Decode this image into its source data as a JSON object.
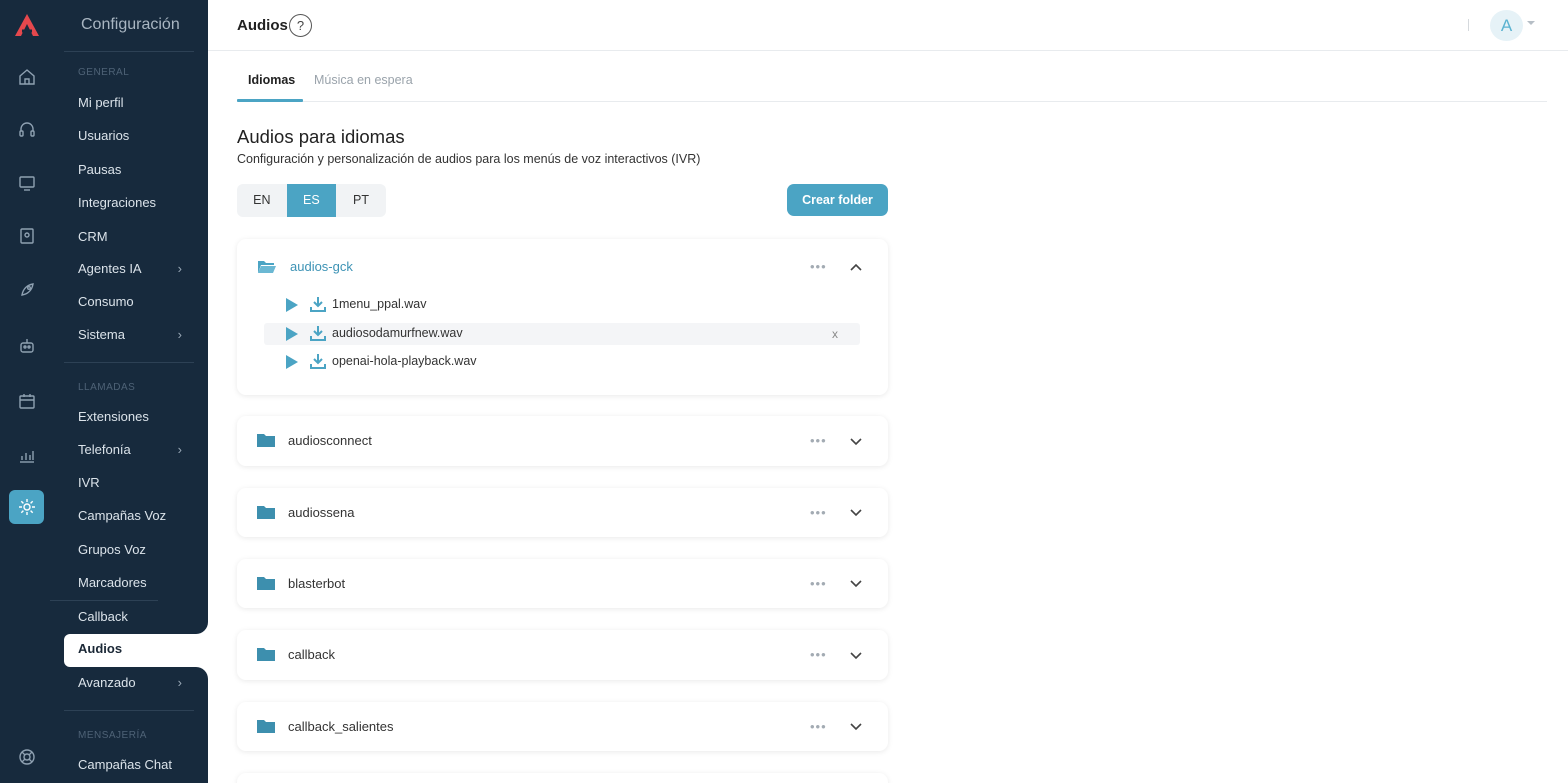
{
  "sidebar": {
    "title": "Configuración",
    "sections": {
      "general": "GENERAL",
      "llamadas": "LLAMADAS",
      "mensajeria": "MENSAJERÍA"
    },
    "items": {
      "mi_perfil": "Mi perfil",
      "usuarios": "Usuarios",
      "pausas": "Pausas",
      "integraciones": "Integraciones",
      "crm": "CRM",
      "agentes_ia": "Agentes IA",
      "consumo": "Consumo",
      "sistema": "Sistema",
      "extensiones": "Extensiones",
      "telefonia": "Telefonía",
      "ivr": "IVR",
      "campanas_voz": "Campañas Voz",
      "grupos_voz": "Grupos Voz",
      "marcadores": "Marcadores",
      "callback": "Callback",
      "audios": "Audios",
      "avanzado": "Avanzado",
      "campanas_chat": "Campañas Chat"
    }
  },
  "header": {
    "title": "Audios",
    "help": "?",
    "avatar": "A"
  },
  "tabs": {
    "idiomas": "Idiomas",
    "musica": "Música en espera"
  },
  "main": {
    "heading": "Audios para idiomas",
    "description": "Configuración y personalización de audios para los menús de voz interactivos (IVR)",
    "languages": [
      "EN",
      "ES",
      "PT"
    ],
    "selected_language": "ES",
    "create_folder": "Crear folder",
    "open_folder": {
      "name": "audios-gck",
      "files": [
        "1menu_ppal.wav",
        "audiosodamurfnew.wav",
        "openai-hola-playback.wav"
      ],
      "remove_label": "x"
    },
    "folders": [
      "audiosconnect",
      "audiossena",
      "blasterbot",
      "callback",
      "callback_salientes"
    ],
    "more": "•••"
  },
  "colors": {
    "accent": "#4ba4c4",
    "sidebar_bg": "#172a3d"
  }
}
